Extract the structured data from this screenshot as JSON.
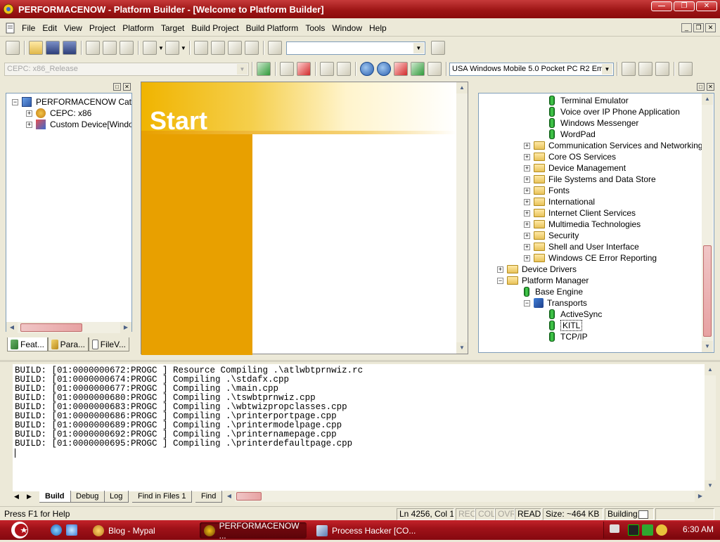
{
  "window": {
    "title": "PERFORMACENOW - Platform Builder - [Welcome to Platform Builder]"
  },
  "menu": [
    "File",
    "Edit",
    "View",
    "Project",
    "Platform",
    "Target",
    "Build Project",
    "Build Platform",
    "Tools",
    "Window",
    "Help"
  ],
  "toolbar": {
    "config_combo": "CEPC: x86_Release",
    "sdk_combo": "USA Windows Mobile 5.0 Pocket PC R2 Em"
  },
  "workspace": {
    "root": "PERFORMACENOW Catal",
    "children": [
      "CEPC: x86",
      "Custom Device[Windo"
    ],
    "tabs": [
      "Feat...",
      "Para...",
      "FileV..."
    ]
  },
  "start_page": {
    "heading": "Start"
  },
  "catalog": {
    "items": [
      {
        "label": "Terminal Emulator",
        "kind": "component"
      },
      {
        "label": "Voice over IP Phone Application",
        "kind": "component"
      },
      {
        "label": "Windows Messenger",
        "kind": "component"
      },
      {
        "label": "WordPad",
        "kind": "component"
      },
      {
        "label": "Communication Services and Networking",
        "kind": "folder"
      },
      {
        "label": "Core OS Services",
        "kind": "folder"
      },
      {
        "label": "Device Management",
        "kind": "folder"
      },
      {
        "label": "File Systems and Data Store",
        "kind": "folder"
      },
      {
        "label": "Fonts",
        "kind": "folder"
      },
      {
        "label": "International",
        "kind": "folder"
      },
      {
        "label": "Internet Client Services",
        "kind": "folder"
      },
      {
        "label": "Multimedia Technologies",
        "kind": "folder"
      },
      {
        "label": "Security",
        "kind": "folder"
      },
      {
        "label": "Shell and User Interface",
        "kind": "folder"
      },
      {
        "label": "Windows CE Error Reporting",
        "kind": "folder"
      },
      {
        "label": "Device Drivers",
        "kind": "folder"
      },
      {
        "label": "Platform Manager",
        "kind": "folder-open"
      },
      {
        "label": "Base Engine",
        "kind": "component"
      },
      {
        "label": "Transports",
        "kind": "transport"
      },
      {
        "label": "ActiveSync",
        "kind": "component"
      },
      {
        "label": "KITL",
        "kind": "component"
      },
      {
        "label": "TCP/IP",
        "kind": "component"
      }
    ]
  },
  "output": {
    "lines": [
      "BUILD: [01:0000000672:PROGC ] Resource Compiling .\\atlwbtprnwiz.rc",
      "BUILD: [01:0000000674:PROGC ] Compiling .\\stdafx.cpp",
      "BUILD: [01:0000000677:PROGC ] Compiling .\\main.cpp",
      "BUILD: [01:0000000680:PROGC ] Compiling .\\tswbtprnwiz.cpp",
      "BUILD: [01:0000000683:PROGC ] Compiling .\\wbtwizpropclasses.cpp",
      "BUILD: [01:0000000686:PROGC ] Compiling .\\printerportpage.cpp",
      "BUILD: [01:0000000689:PROGC ] Compiling .\\printermodelpage.cpp",
      "BUILD: [01:0000000692:PROGC ] Compiling .\\printernamepage.cpp",
      "BUILD: [01:0000000695:PROGC ] Compiling .\\printerdefaultpage.cpp"
    ],
    "tabs": [
      "Build",
      "Debug",
      "Log",
      "Find in Files 1",
      "Find"
    ]
  },
  "status": {
    "help": "Press F1 for Help",
    "position": "Ln 4256, Col 1",
    "rec": "REC",
    "col": "COL",
    "ovr": "OVR",
    "read": "READ",
    "size": "Size: ~464 KB",
    "building": "Building:"
  },
  "taskbar": {
    "buttons": [
      "Blog - Mypal",
      "PERFORMACENOW ...",
      "Process Hacker [CO..."
    ],
    "clock": "6:30 AM"
  },
  "colors": {
    "titlebar": "#9e1616",
    "taskbar": "#a01219",
    "start_orange": "#e8a000"
  }
}
